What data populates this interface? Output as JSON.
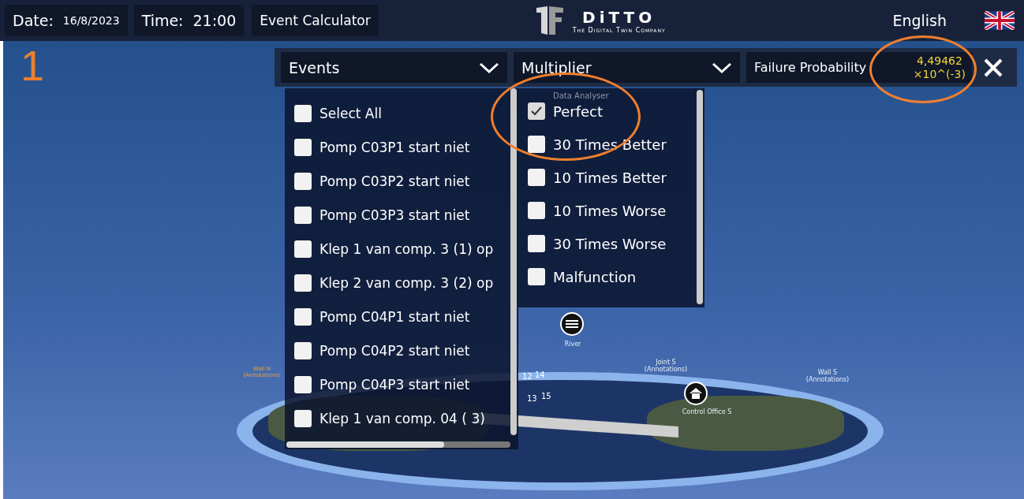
{
  "top_bar": {
    "date_label": "Date:",
    "date": "16/8/2023",
    "time_label": "Time:",
    "time": "21:00",
    "event_calculator": "Event Calculator",
    "logo_name": "DiTTO",
    "logo_tagline": "The Digital Twin Company",
    "language": "English"
  },
  "annotation_number": "1",
  "dropdowns": [
    {
      "label": "Events",
      "expanded": true
    },
    {
      "label": "Multiplier",
      "expanded": true
    }
  ],
  "failure_probability": {
    "label": "Failure Probability",
    "value_line_1": "4,49462",
    "value_line_2": "×10^(-3)"
  },
  "events": [
    {
      "label": "Select All",
      "checked": false
    },
    {
      "label": "Pomp C03P1 start niet",
      "checked": false
    },
    {
      "label": "Pomp C03P2 start niet",
      "checked": false
    },
    {
      "label": "Pomp C03P3 start niet",
      "checked": false
    },
    {
      "label": "Klep 1 van comp. 3 (1) op",
      "checked": false
    },
    {
      "label": "Klep 2 van comp. 3 (2) op",
      "checked": false
    },
    {
      "label": "Pomp C04P1 start niet",
      "checked": false
    },
    {
      "label": "Pomp C04P2 start niet",
      "checked": false
    },
    {
      "label": "Pomp C04P3 start niet",
      "checked": false
    },
    {
      "label": "Klep 1 van comp. 04 ( 3)",
      "checked": false
    }
  ],
  "multiplier_header": "Data Analyser",
  "multipliers": [
    {
      "label": "Perfect",
      "checked": true
    },
    {
      "label": "30 Times Better",
      "checked": false
    },
    {
      "label": "10 Times Better",
      "checked": false
    },
    {
      "label": "10 Times Worse",
      "checked": false
    },
    {
      "label": "30 Times Worse",
      "checked": false
    },
    {
      "label": "Malfunction",
      "checked": false
    }
  ],
  "scene_labels": [
    {
      "text": "Wall N (Annotations)",
      "kind": "annotation"
    },
    {
      "text": "River",
      "kind": "river"
    },
    {
      "text": "Joint S (Annotations)",
      "kind": "joint"
    },
    {
      "text": "Wall S (Annotations)",
      "kind": "wall"
    },
    {
      "text": "Control Office S",
      "kind": "office_s"
    }
  ],
  "pins": [
    "12",
    "14",
    "13",
    "15"
  ]
}
